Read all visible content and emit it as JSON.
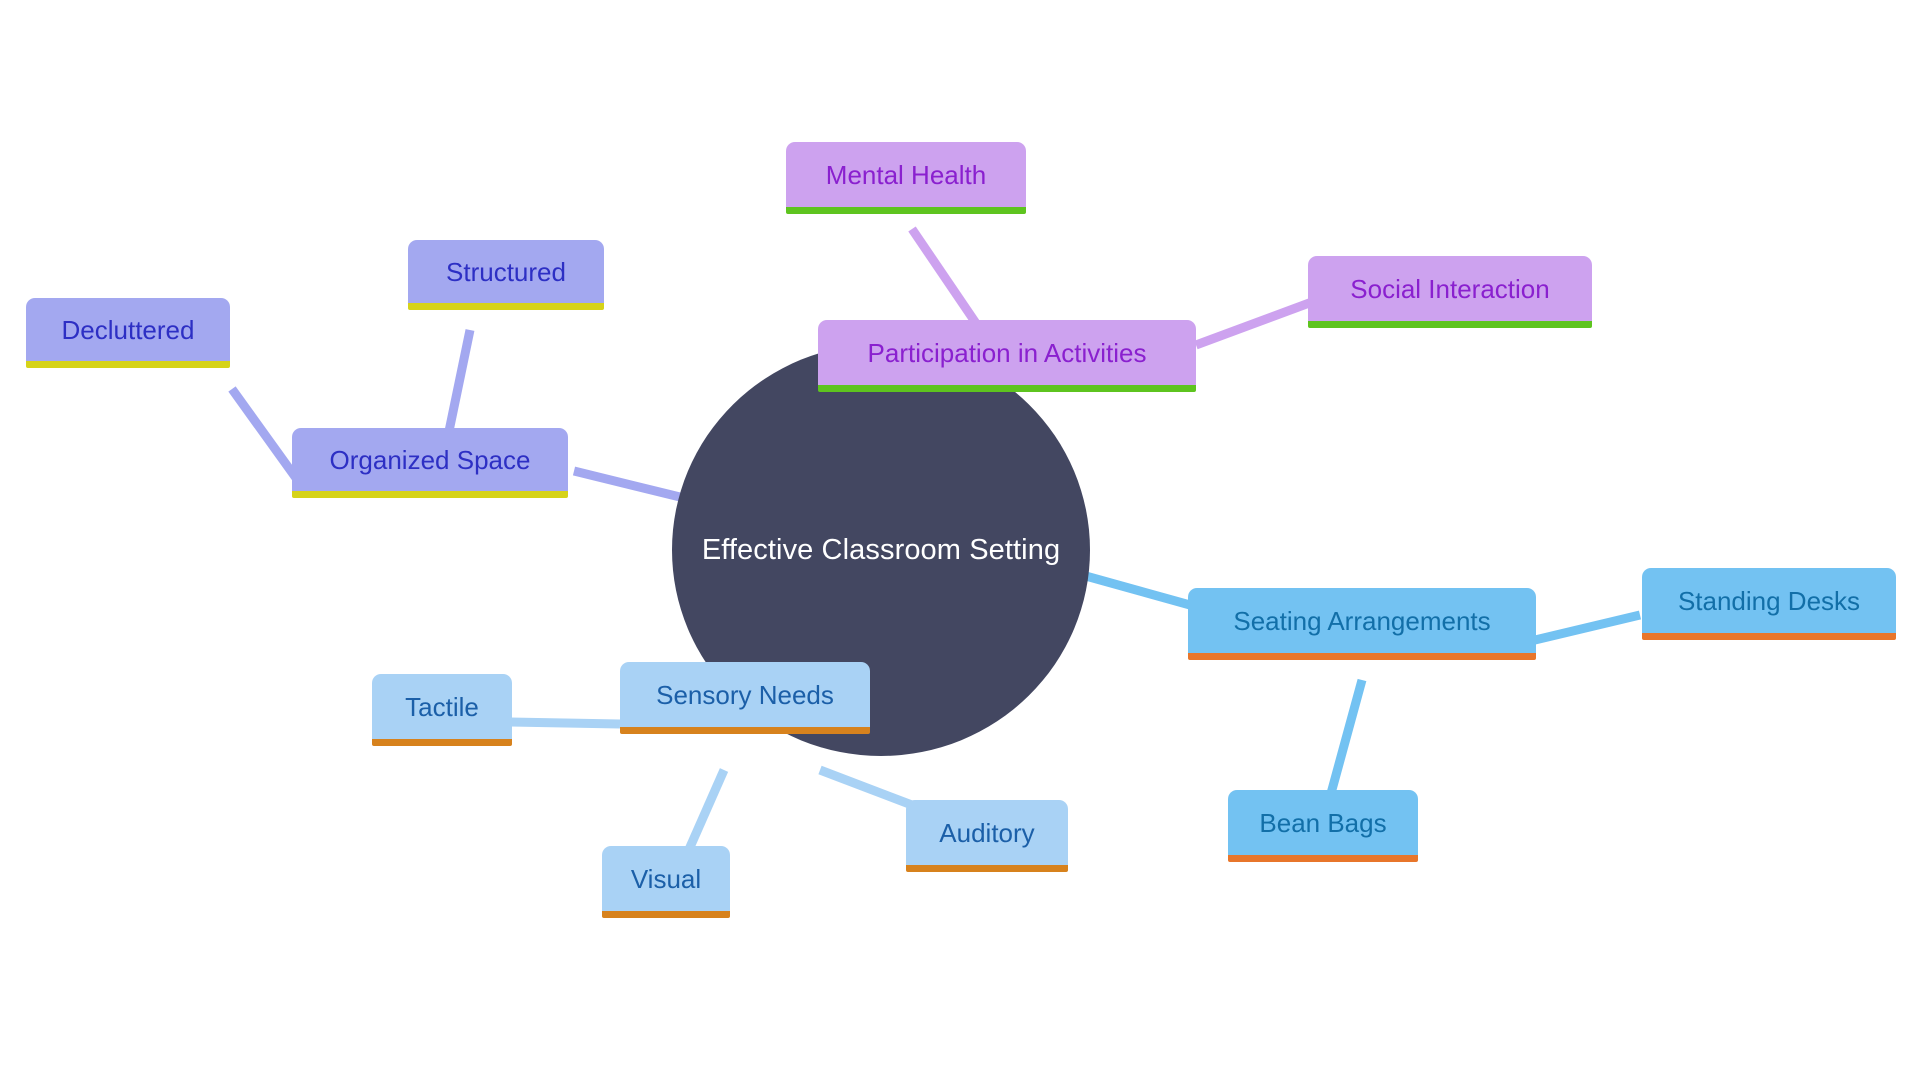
{
  "diagram": {
    "type": "mind-map",
    "background_color": "#ffffff",
    "root": {
      "label": "Effective Classroom Setting",
      "fill": "#434761",
      "text_color": "#ffffff"
    },
    "palette": {
      "purple_fill": "#a3a8f0",
      "purple_accent": "#d6d319",
      "purple_text": "#2d2fc4",
      "orchid_fill": "#cda2ef",
      "orchid_accent": "#5ec41f",
      "orchid_text": "#8a20cf",
      "blue_fill": "#73c2f2",
      "blue_accent": "#e8762b",
      "blue_text": "#126fa8",
      "lightblue_fill": "#a9d2f5",
      "lightblue_accent": "#d7821d",
      "lightblue_text": "#1b5fa8"
    },
    "nodes": [
      {
        "id": "organized_space",
        "label": "Organized Space",
        "family": "purple"
      },
      {
        "id": "decluttered",
        "label": "Decluttered",
        "family": "purple"
      },
      {
        "id": "structured",
        "label": "Structured",
        "family": "purple"
      },
      {
        "id": "participation",
        "label": "Participation in Activities",
        "family": "orchid"
      },
      {
        "id": "mental_health",
        "label": "Mental Health",
        "family": "orchid"
      },
      {
        "id": "social_interaction",
        "label": "Social Interaction",
        "family": "orchid"
      },
      {
        "id": "seating",
        "label": "Seating Arrangements",
        "family": "blue"
      },
      {
        "id": "standing_desks",
        "label": "Standing Desks",
        "family": "blue"
      },
      {
        "id": "bean_bags",
        "label": "Bean Bags",
        "family": "blue"
      },
      {
        "id": "sensory_needs",
        "label": "Sensory Needs",
        "family": "lightblue"
      },
      {
        "id": "tactile",
        "label": "Tactile",
        "family": "lightblue"
      },
      {
        "id": "visual",
        "label": "Visual",
        "family": "lightblue"
      },
      {
        "id": "auditory",
        "label": "Auditory",
        "family": "lightblue"
      }
    ],
    "edges": [
      {
        "from": "root",
        "to": "organized_space",
        "color": "#a3a8f0"
      },
      {
        "from": "organized_space",
        "to": "decluttered",
        "color": "#a3a8f0"
      },
      {
        "from": "organized_space",
        "to": "structured",
        "color": "#a3a8f0"
      },
      {
        "from": "root",
        "to": "participation",
        "color": "#cda2ef"
      },
      {
        "from": "participation",
        "to": "mental_health",
        "color": "#cda2ef"
      },
      {
        "from": "participation",
        "to": "social_interaction",
        "color": "#cda2ef"
      },
      {
        "from": "root",
        "to": "seating",
        "color": "#73c2f2"
      },
      {
        "from": "seating",
        "to": "standing_desks",
        "color": "#73c2f2"
      },
      {
        "from": "seating",
        "to": "bean_bags",
        "color": "#73c2f2"
      },
      {
        "from": "root",
        "to": "sensory_needs",
        "color": "#a9d2f5"
      },
      {
        "from": "sensory_needs",
        "to": "tactile",
        "color": "#a9d2f5"
      },
      {
        "from": "sensory_needs",
        "to": "visual",
        "color": "#a9d2f5"
      },
      {
        "from": "sensory_needs",
        "to": "auditory",
        "color": "#a9d2f5"
      }
    ]
  }
}
